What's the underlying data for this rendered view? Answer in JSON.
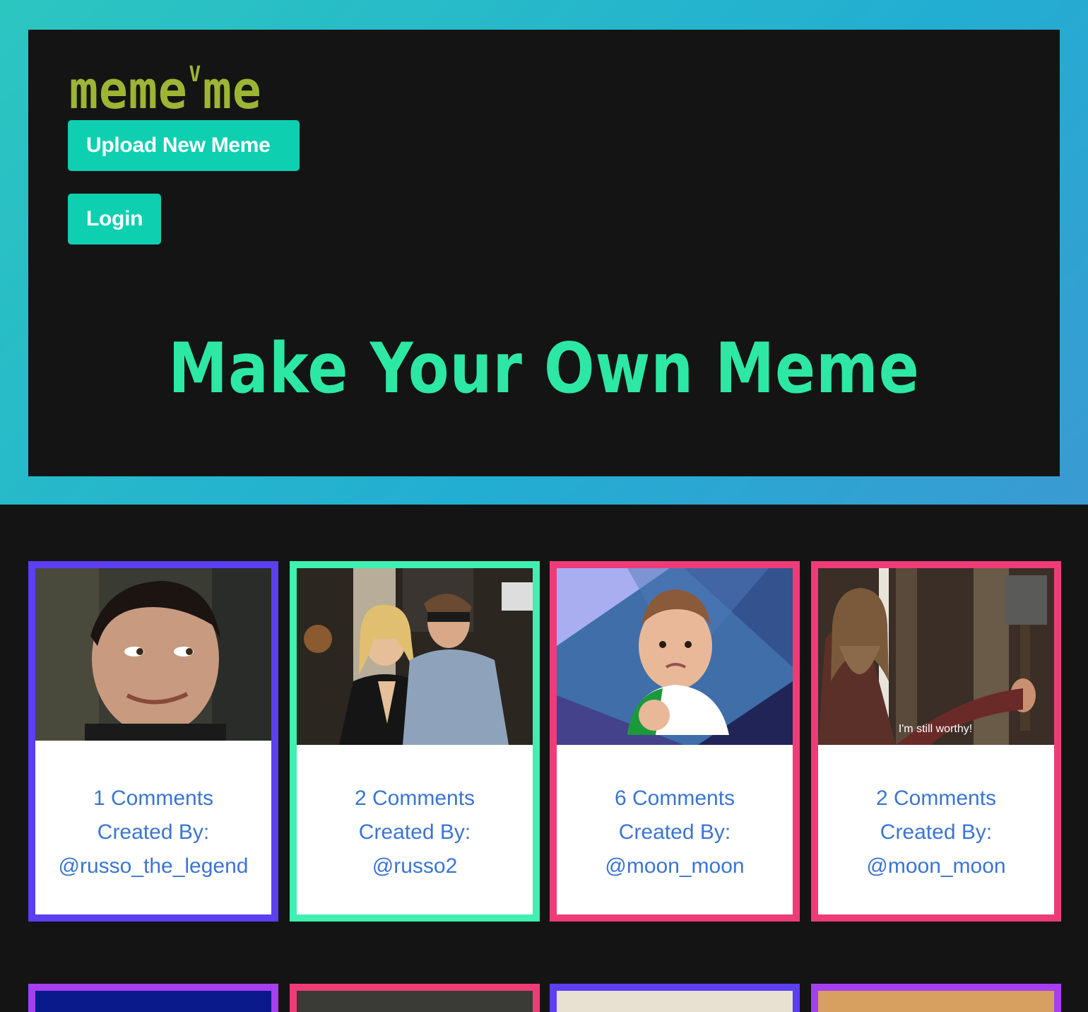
{
  "header": {
    "logo_left": "meme",
    "logo_sup": "V",
    "logo_right": "me",
    "upload_label": "Upload New Meme",
    "login_label": "Login",
    "headline": "Make Your Own Meme"
  },
  "colors": {
    "accent_button": "#0fcfb1",
    "headline": "#2de8a5",
    "logo": "#9db534",
    "link": "#3b75d1"
  },
  "memes": [
    {
      "comments": "1 Comments",
      "created_by": "Created By:",
      "user": "@russo_the_legend",
      "border": "#5b3ff0",
      "image": "smirking-man-image"
    },
    {
      "comments": "2 Comments",
      "created_by": "Created By:",
      "user": "@russo2",
      "border": "#3ff0b0",
      "image": "couple-photo-image"
    },
    {
      "comments": "6 Comments",
      "created_by": "Created By:",
      "user": "@moon_moon",
      "border": "#ee3c78",
      "image": "success-kid-image"
    },
    {
      "comments": "2 Comments",
      "created_by": "Created By:",
      "user": "@moon_moon",
      "border": "#ee3c78",
      "image": "bearded-man-hammer-image",
      "caption": "I'm still worthy!"
    }
  ],
  "memes_row2_borders": [
    "#a53ff0",
    "#ee3c78",
    "#5b3ff0",
    "#a53ff0"
  ]
}
